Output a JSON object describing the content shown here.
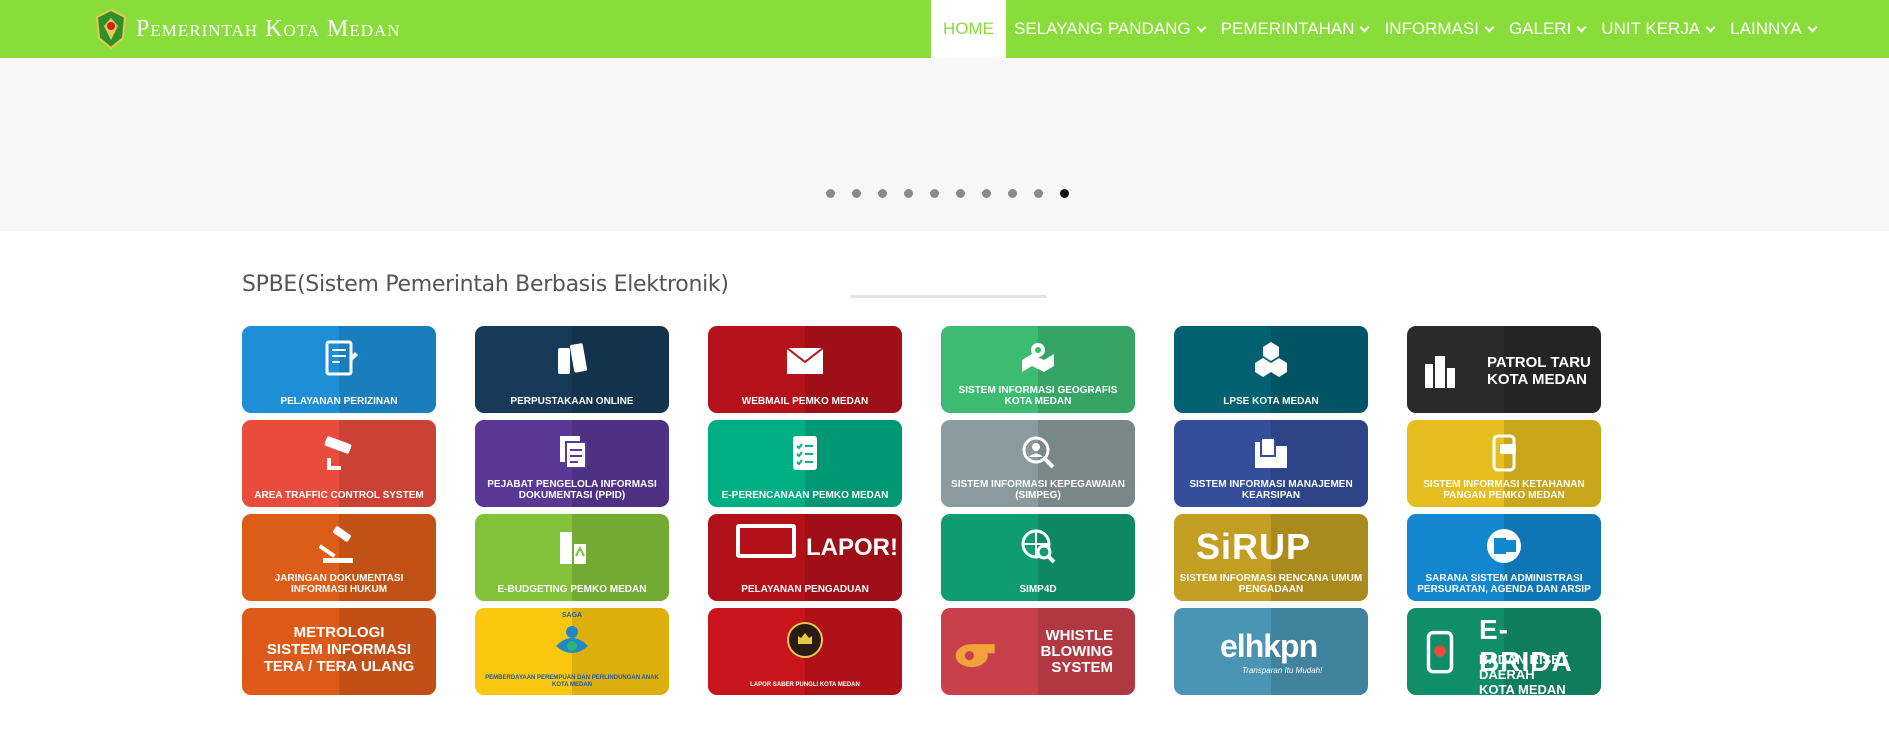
{
  "header": {
    "brand": "Pemerintah Kota Medan",
    "nav": [
      {
        "label": "HOME",
        "active": true,
        "dropdown": false
      },
      {
        "label": "SELAYANG PANDANG",
        "dropdown": true
      },
      {
        "label": "PEMERINTAHAN",
        "dropdown": true
      },
      {
        "label": "INFORMASI",
        "dropdown": true
      },
      {
        "label": "GALERI",
        "dropdown": true
      },
      {
        "label": "UNIT KERJA",
        "dropdown": true
      },
      {
        "label": "LAINNYA",
        "dropdown": true
      }
    ],
    "color": "#88dd3b"
  },
  "slider": {
    "dot_count": 10,
    "active_dot": 10
  },
  "section": {
    "title": "SPBE(Sistem Pemerintah Berbasis Elektronik)"
  },
  "tiles": [
    {
      "label": "PELAYANAN PERIZINAN",
      "color": "#1e8fd6",
      "icon": "document-sign-icon"
    },
    {
      "label": "PERPUSTAKAAN ONLINE",
      "color": "#163a57",
      "icon": "books-icon"
    },
    {
      "label": "WEBMAIL PEMKO MEDAN",
      "color": "#b5121b",
      "icon": "mail-icon"
    },
    {
      "label": "SISTEM INFORMASI GEOGRAFIS KOTA MEDAN",
      "color": "#3dbb73",
      "icon": "map-pin-icon"
    },
    {
      "label": "LPSE KOTA MEDAN",
      "color": "#016071",
      "icon": "hexagons-icon"
    },
    {
      "label": "PATROL TARU KOTA MEDAN",
      "color": "#2a2a2a",
      "icon": "buildings-icon"
    },
    {
      "label": "AREA TRAFFIC CONTROL SYSTEM",
      "color": "#e84c3d",
      "icon": "cctv-icon"
    },
    {
      "label": "PEJABAT PENGELOLA INFORMASI DOKUMENTASI (PPID)",
      "color": "#5a3896",
      "icon": "documents-icon"
    },
    {
      "label": "E-PERENCANAAN PEMKO MEDAN",
      "color": "#00ae84",
      "icon": "checklist-icon"
    },
    {
      "label": "SISTEM INFORMASI KEPEGAWAIAN (SIMPEG)",
      "color": "#8a9a9e",
      "icon": "person-search-icon"
    },
    {
      "label": "SISTEM INFORMASI MANAJEMEN KEARSIPAN",
      "color": "#344e9b",
      "icon": "folder-icon"
    },
    {
      "label": "SISTEM INFORMASI KETAHANAN PANGAN PEMKO MEDAN",
      "color": "#e6be1f",
      "icon": "phone-chat-icon"
    },
    {
      "label": "JARINGAN DOKUMENTASI INFORMASI HUKUM",
      "color": "#dc5d17",
      "icon": "gavel-icon"
    },
    {
      "label": "E-BUDGETING PEMKO MEDAN",
      "color": "#82c23a",
      "icon": "building-icon"
    },
    {
      "label": "PELAYANAN PENGADUAN",
      "color": "#b3111a",
      "icon": "lapor-icon",
      "big": "LAPOR!"
    },
    {
      "label": "SIMP4D",
      "color": "#109b72",
      "icon": "globe-search-icon"
    },
    {
      "label": "SISTEM INFORMASI RENCANA UMUM PENGADAAN",
      "color": "#c29e22",
      "icon": "sirup-icon",
      "big": "SiRUP"
    },
    {
      "label": "SARANA SISTEM ADMINISTRASI PERSURATAN, AGENDA DAN ARSIP",
      "color": "#1287d0",
      "icon": "outlook-icon"
    },
    {
      "label": "",
      "color": "#dd5a19",
      "icon": "none",
      "big": "METROLOGI\nSISTEM INFORMASI\nTERA / TERA ULANG"
    },
    {
      "label": "PEMBERDAYAAN PEREMPUAN DAN PERLINDUNGAN ANAK KOTA MEDAN",
      "color": "#fbc80f",
      "icon": "family-icon",
      "top": "SAGA"
    },
    {
      "label": "LAPOR SABER PUNGLI KOTA MEDAN",
      "color": "#c8141d",
      "icon": "seal-icon"
    },
    {
      "label": "",
      "color": "#c8404a",
      "icon": "whistle-icon",
      "big": "WHISTLE\nBLOWING\nSYSTEM"
    },
    {
      "label": "",
      "color": "#4a94b4",
      "icon": "elhkpn-icon",
      "big": "elhkpn",
      "sub": "Transparan Itu Mudah!"
    },
    {
      "label": "",
      "color": "#108e6a",
      "icon": "phone-icon",
      "big": "E-BRIDA",
      "sub": "BADAN RISET DAERAH\nKOTA MEDAN"
    }
  ]
}
